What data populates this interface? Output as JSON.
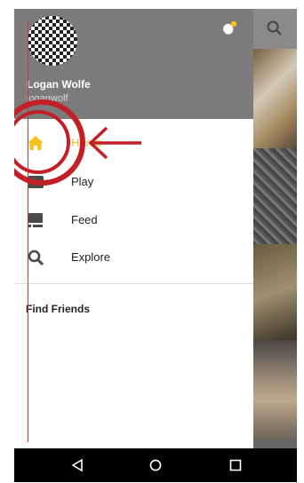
{
  "user": {
    "name": "Logan Wolfe",
    "handle": "loganwolf"
  },
  "menu": {
    "items": [
      {
        "label": "Home",
        "icon": "home-icon",
        "active": true
      },
      {
        "label": "Play",
        "icon": "play-icon"
      },
      {
        "label": "Feed",
        "icon": "feed-icon"
      },
      {
        "label": "Explore",
        "icon": "search-icon"
      }
    ],
    "find_friends": "Find Friends"
  },
  "colors": {
    "accent": "#f3c21d",
    "annotation": "#c21f26",
    "header": "#7b7b7b"
  },
  "navbar": {
    "icons": [
      "back-icon",
      "home-circle-icon",
      "recents-icon"
    ]
  }
}
